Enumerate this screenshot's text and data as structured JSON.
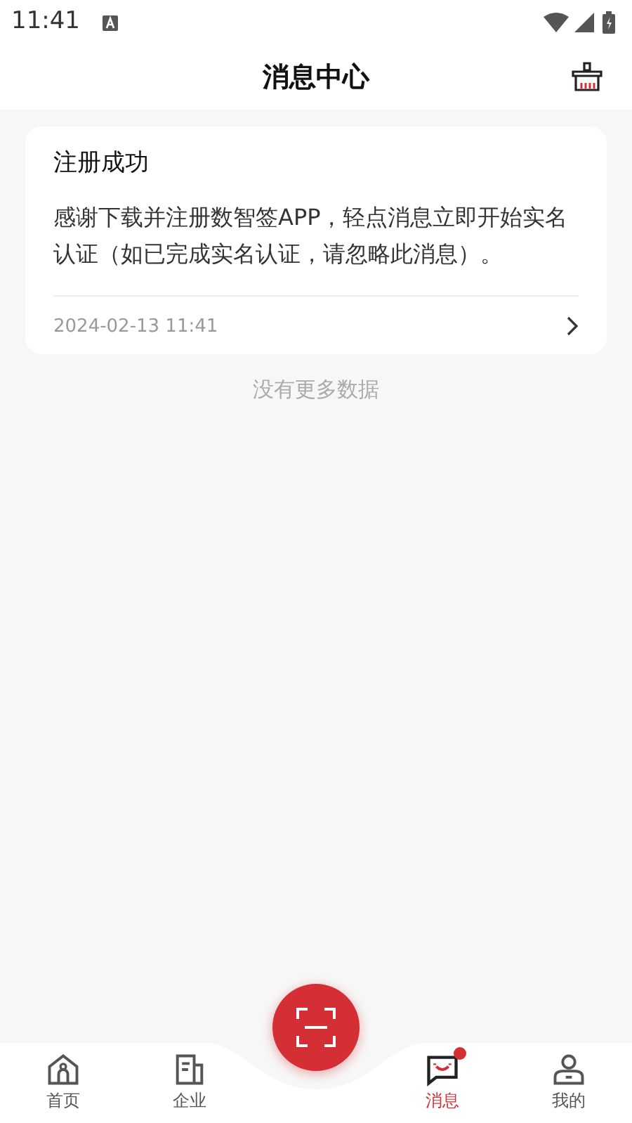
{
  "status_bar": {
    "time": "11:41"
  },
  "header": {
    "title": "消息中心"
  },
  "messages": [
    {
      "title": "注册成功",
      "body": "感谢下载并注册数智签APP，轻点消息立即开始实名认证（如已完成实名认证，请忽略此消息）。",
      "time": "2024-02-13 11:41"
    }
  ],
  "list_footer": "没有更多数据",
  "tabs": [
    {
      "kind": "home",
      "label": "首页",
      "selected": false,
      "badge": false
    },
    {
      "kind": "company",
      "label": "企业",
      "selected": false,
      "badge": false
    },
    {
      "kind": "scan",
      "selected": false
    },
    {
      "kind": "message",
      "label": "消息",
      "selected": true,
      "badge": true
    },
    {
      "kind": "profile",
      "label": "我的",
      "selected": false,
      "badge": false
    }
  ]
}
